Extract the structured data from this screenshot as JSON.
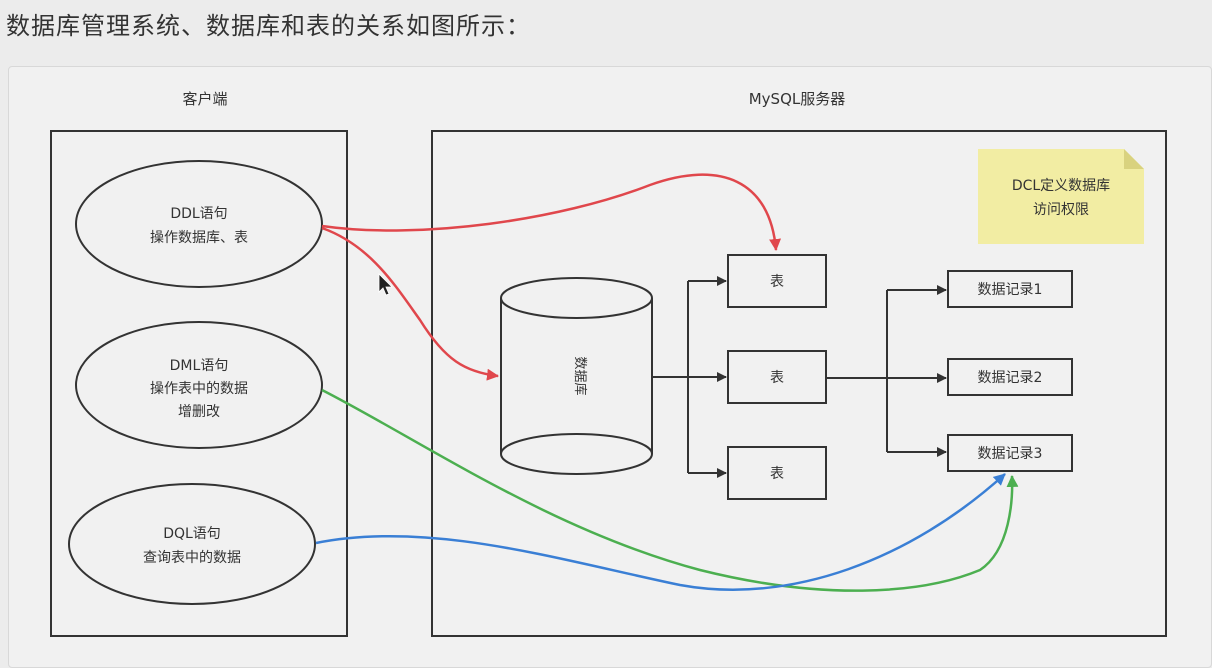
{
  "heading": "数据库管理系统、数据库和表的关系如图所示：",
  "client": {
    "title": "客户端",
    "ddl": {
      "line1": "DDL语句",
      "line2": "操作数据库、表"
    },
    "dml": {
      "line1": "DML语句",
      "line2": "操作表中的数据",
      "line3": "增删改"
    },
    "dql": {
      "line1": "DQL语句",
      "line2": "查询表中的数据"
    }
  },
  "server": {
    "title": "MySQL服务器",
    "database_label": "数据库",
    "tables": [
      "表",
      "表",
      "表"
    ],
    "records": [
      "数据记录1",
      "数据记录2",
      "数据记录3"
    ],
    "note": {
      "line1": "DCL定义数据库",
      "line2": "访问权限"
    }
  },
  "colors": {
    "ddl_arrow": "#e0474c",
    "dml_arrow": "#4caf50",
    "dql_arrow": "#3a7fd5",
    "note_fill": "#f2eda3",
    "ink": "#333333"
  }
}
